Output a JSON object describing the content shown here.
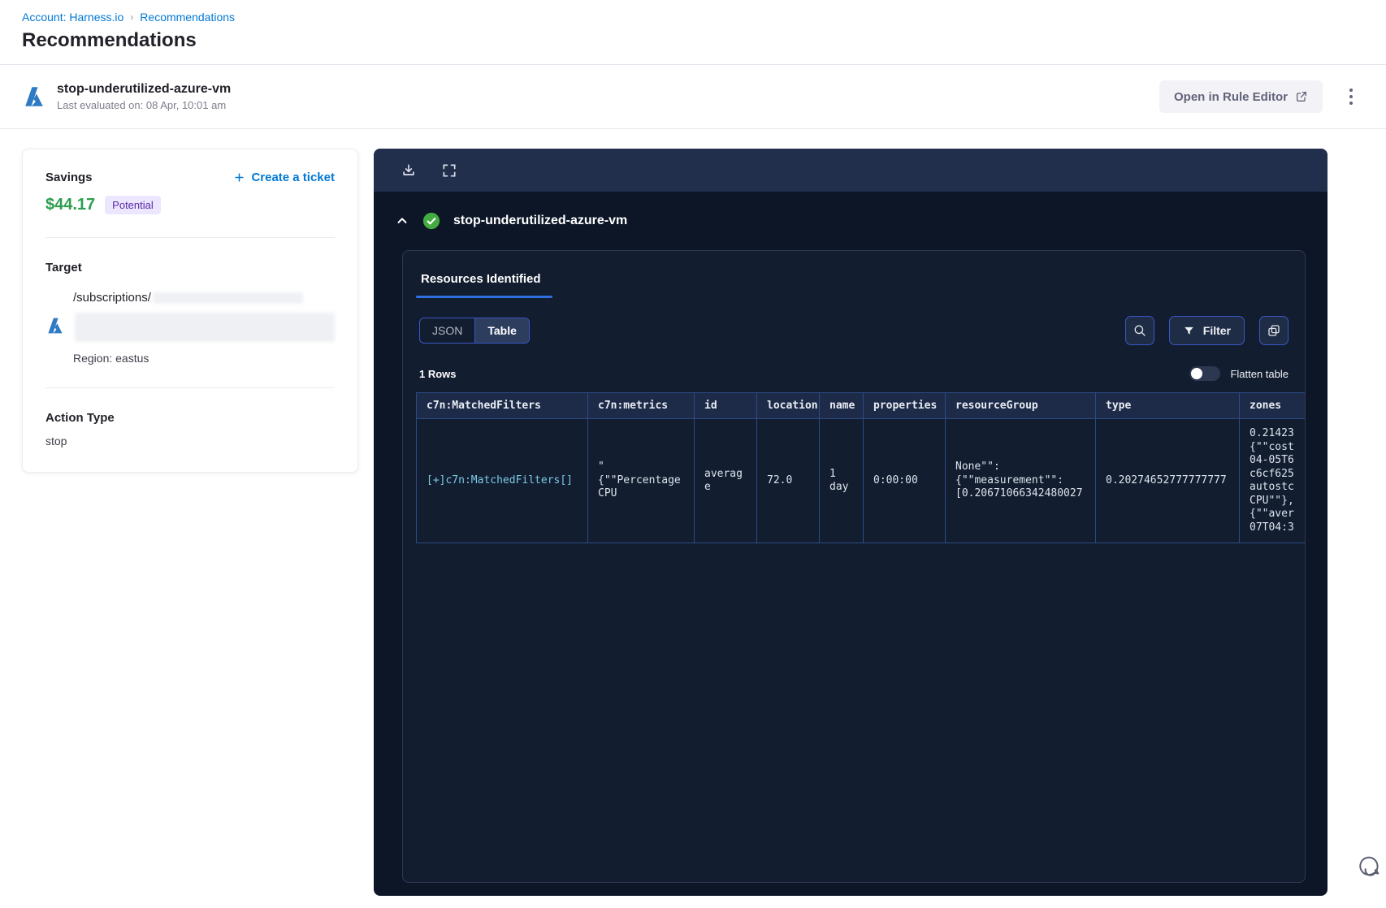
{
  "breadcrumb": {
    "account": "Account: Harness.io",
    "current": "Recommendations"
  },
  "page": {
    "title": "Recommendations"
  },
  "header": {
    "rule_name": "stop-underutilized-azure-vm",
    "last_evaluated": "Last evaluated on: 08 Apr, 10:01 am",
    "open_rule_editor_label": "Open in Rule Editor"
  },
  "savings": {
    "label": "Savings",
    "amount": "$44.17",
    "badge": "Potential",
    "create_ticket_label": "Create a ticket"
  },
  "target": {
    "label": "Target",
    "path": "/subscriptions/",
    "region": "Region: eastus"
  },
  "action": {
    "label": "Action Type",
    "value": "stop"
  },
  "panel": {
    "title": "stop-underutilized-azure-vm",
    "tab": "Resources Identified",
    "view_toggle": {
      "json": "JSON",
      "table": "Table"
    },
    "filter_label": "Filter",
    "rows_count": "1 Rows",
    "flatten_label": "Flatten table",
    "table": {
      "headers": [
        "c7n:MatchedFilters",
        "c7n:metrics",
        "id",
        "location",
        "name",
        "properties",
        "resourceGroup",
        "type",
        "zones"
      ],
      "row": {
        "matched_filters": "[+]c7n:MatchedFilters[]",
        "metrics": "\"\n{\"\"Percentage\nCPU",
        "id": "average",
        "location": "72.0",
        "name": "1\nday",
        "properties": "0:00:00",
        "resource_group": "None\"\":\n{\"\"measurement\"\":\n[0.20671066342480027",
        "type": "0.20274652777777777",
        "zones": "0.21423\n{\"\"cost\n04-05T6\nc6cf625\nautostc\nCPU\"\"},\n{\"\"aver\n07T04:3"
      }
    }
  },
  "icons": {
    "download": "download-icon",
    "fullscreen": "fullscreen-icon",
    "search": "search-icon",
    "filter": "filter-icon",
    "copy": "copy-icon",
    "kebab": "kebab-menu-icon",
    "external_link": "external-link-icon",
    "chat": "chat-bubble-icon",
    "azure": "azure-logo-icon",
    "check": "success-check-icon",
    "chevron_up": "chevron-up-icon",
    "plus": "plus-icon"
  },
  "colors": {
    "link_blue": "#0278d5",
    "savings_green": "#2e9e4f",
    "badge_bg": "#ece6ff",
    "badge_text": "#592baa",
    "panel_bg": "#0c1627",
    "panel_toolbar_bg": "#212e4c",
    "inner_panel_bg": "#121d30",
    "table_border": "#2b4a86",
    "table_header_bg": "#1e2b48",
    "accent_underline": "#2f6fe0",
    "button_border": "#3a57c4",
    "button_bg": "#1f2c45",
    "success_green": "#42ab42",
    "cell_link": "#7cc9e4",
    "azure_blue": "#2e7bc4"
  }
}
